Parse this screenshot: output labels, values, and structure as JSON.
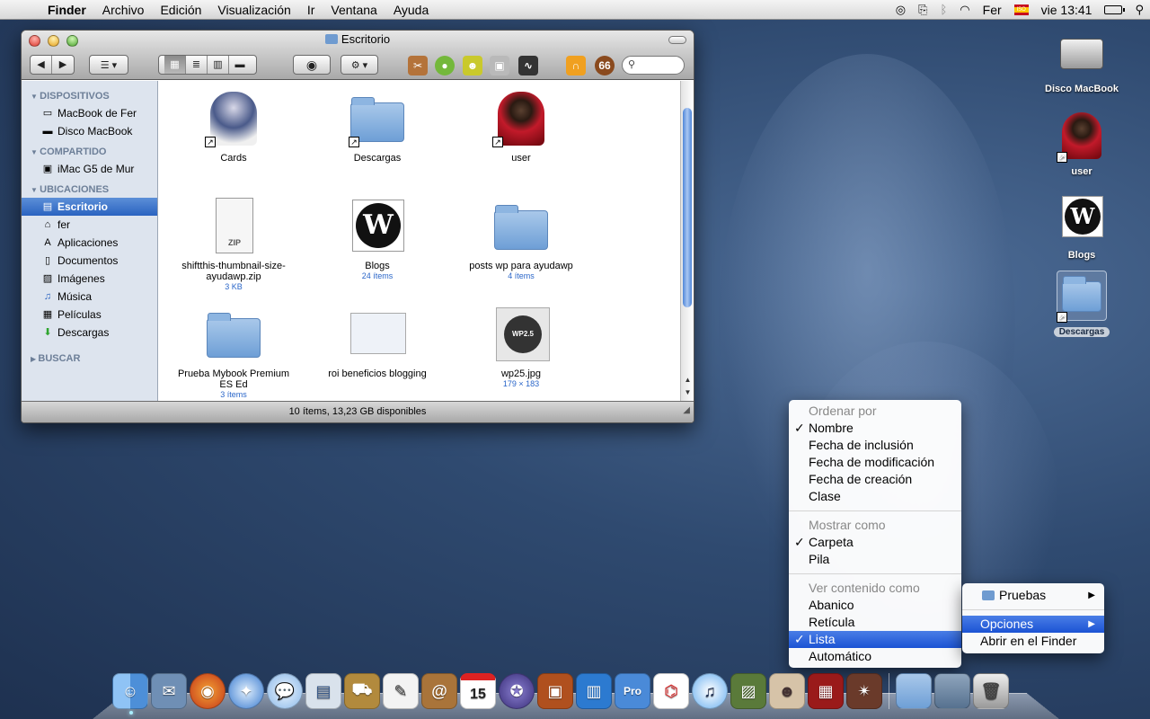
{
  "colors": {
    "accent": "#2a63c0",
    "menu_highlight": "#1b53d4",
    "subtext": "#2a66c9"
  },
  "menubar": {
    "apple_icon": "apple-icon",
    "items": [
      "Finder",
      "Archivo",
      "Edición",
      "Visualización",
      "Ir",
      "Ventana",
      "Ayuda"
    ],
    "status": {
      "user": "Fer",
      "flag_text": "ISO",
      "clock": "vie 13:41"
    }
  },
  "finder": {
    "title": "Escritorio",
    "statusbar": "10 ítems, 13,23 GB disponibles",
    "sidebar": {
      "dispositivos_header": "DISPOSITIVOS",
      "dispositivos": [
        "MacBook de Fer",
        "Disco MacBook"
      ],
      "compartido_header": "COMPARTIDO",
      "compartido": [
        "iMac G5 de Mur"
      ],
      "ubicaciones_header": "UBICACIONES",
      "ubicaciones": [
        "Escritorio",
        "fer",
        "Aplicaciones",
        "Documentos",
        "Imágenes",
        "Música",
        "Películas",
        "Descargas"
      ],
      "buscar_header": "BUSCAR"
    },
    "items": [
      {
        "name": "Cards",
        "sub": ""
      },
      {
        "name": "Descargas",
        "sub": ""
      },
      {
        "name": "user",
        "sub": ""
      },
      {
        "name": "shiftthis-thumbnail-size-ayudawp.zip",
        "sub": "3 KB",
        "zip_label": "ZIP"
      },
      {
        "name": "Blogs",
        "sub": "24 ítems"
      },
      {
        "name": "posts wp para ayudawp",
        "sub": "4 ítems"
      },
      {
        "name": "Prueba Mybook Premium ES Ed",
        "sub": "3 ítems"
      },
      {
        "name": "roi beneficios blogging",
        "sub": ""
      },
      {
        "name": "wp25.jpg",
        "sub": "179 × 183",
        "seal_text": "WP2.5"
      }
    ]
  },
  "desktop": {
    "icons": [
      "Disco MacBook",
      "user",
      "Blogs",
      "Descargas"
    ]
  },
  "stack_menu": {
    "ordenar_header": "Ordenar por",
    "ordenar": [
      "Nombre",
      "Fecha de inclusión",
      "Fecha de modificación",
      "Fecha de creación",
      "Clase"
    ],
    "mostrar_header": "Mostrar como",
    "mostrar": [
      "Carpeta",
      "Pila"
    ],
    "ver_header": "Ver contenido como",
    "ver": [
      "Abanico",
      "Retícula",
      "Lista",
      "Automático"
    ]
  },
  "folder_menu": {
    "items": [
      "Pruebas",
      "Opciones",
      "Abrir en el Finder"
    ]
  },
  "dock": {
    "apps": [
      {
        "name": "finder",
        "glyph": "☺"
      },
      {
        "name": "mail-stamp",
        "glyph": "✉"
      },
      {
        "name": "firefox",
        "glyph": "◉"
      },
      {
        "name": "safari",
        "glyph": "✦"
      },
      {
        "name": "ichat",
        "glyph": "💬"
      },
      {
        "name": "preview",
        "glyph": "▤"
      },
      {
        "name": "transmit",
        "glyph": "⛟"
      },
      {
        "name": "textedit",
        "glyph": "✎"
      },
      {
        "name": "address-book",
        "glyph": "@"
      },
      {
        "name": "ical",
        "glyph": "15"
      },
      {
        "name": "iweb",
        "glyph": "✪"
      },
      {
        "name": "keynote",
        "glyph": "▣"
      },
      {
        "name": "numbers",
        "glyph": "▥"
      },
      {
        "name": "pro-app",
        "glyph": "Pro"
      },
      {
        "name": "acrobat",
        "glyph": "⌬"
      },
      {
        "name": "itunes",
        "glyph": "♫"
      },
      {
        "name": "iphoto",
        "glyph": "▨"
      },
      {
        "name": "photo-booth",
        "glyph": "☻"
      },
      {
        "name": "front-row",
        "glyph": "▦"
      },
      {
        "name": "game",
        "glyph": "✴"
      }
    ]
  }
}
